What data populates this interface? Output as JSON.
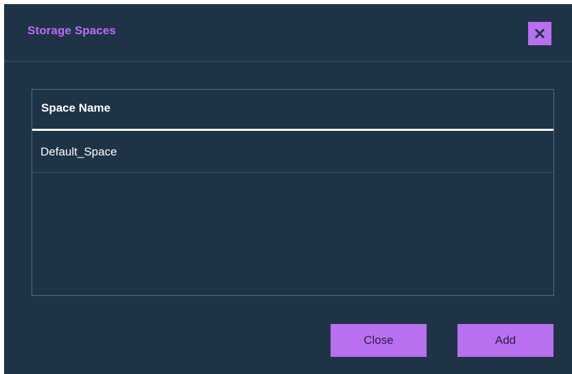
{
  "dialog": {
    "title": "Storage Spaces",
    "close_icon": "close-icon"
  },
  "table": {
    "columns": [
      "Space Name"
    ],
    "rows": [
      {
        "space_name": "Default_Space"
      }
    ]
  },
  "footer": {
    "close_label": "Close",
    "add_label": "Add"
  },
  "colors": {
    "background": "#1f3347",
    "accent": "#b870f0",
    "title": "#bf6bff"
  }
}
